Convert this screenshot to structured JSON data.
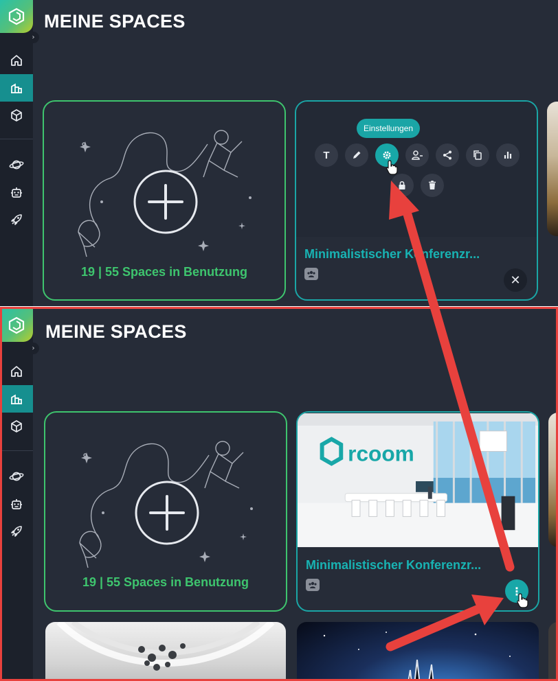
{
  "page": {
    "title": "MEINE SPACES"
  },
  "sidebar": {
    "items": [
      {
        "name": "home",
        "icon": "home-icon"
      },
      {
        "name": "spaces",
        "icon": "buildings-icon",
        "active": true
      },
      {
        "name": "objects",
        "icon": "cube-icon"
      },
      {
        "name": "planets",
        "icon": "planet-icon"
      },
      {
        "name": "bots",
        "icon": "robot-icon"
      },
      {
        "name": "launch",
        "icon": "rocket-icon"
      }
    ]
  },
  "add_card": {
    "usage": "19 | 55 Spaces in Benutzung"
  },
  "space_card": {
    "name": "Minimalistischer Konferenzr...",
    "name_overlapped": "Minimalistischer Konferenzr..."
  },
  "menu": {
    "tooltip": "Einstellungen",
    "actions": [
      {
        "name": "title-action",
        "label": "T"
      },
      {
        "name": "edit-action"
      },
      {
        "name": "settings-action",
        "highlighted": true
      },
      {
        "name": "members-action"
      },
      {
        "name": "share-action"
      },
      {
        "name": "duplicate-action"
      },
      {
        "name": "stats-action"
      },
      {
        "name": "lock-action"
      },
      {
        "name": "delete-action"
      }
    ]
  },
  "colors": {
    "background": "#262c38",
    "sidebar": "#1c212b",
    "accent": "#18a7a8",
    "green": "#3ec56e",
    "annotation": "#e8413d"
  }
}
